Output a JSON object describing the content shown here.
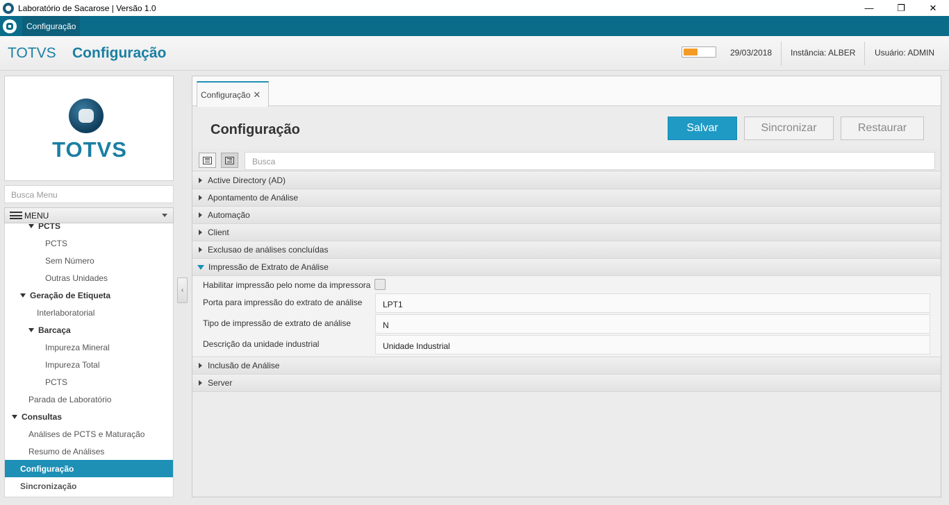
{
  "window": {
    "title": "Laboratório de Sacarose | Versão 1.0",
    "minimize": "—",
    "restore": "❐",
    "close": "✕"
  },
  "menubar": {
    "tab_label": "Configuração"
  },
  "header": {
    "brand": "TOTVS",
    "title": "Configuração",
    "progress_fraction": 0.45,
    "date": "29/03/2018",
    "instance": "Instância: ALBER",
    "user": "Usuário: ADMIN"
  },
  "sidebar": {
    "logo_text": "TOTVS",
    "search_placeholder": "Busca Menu",
    "menu_label": "MENU",
    "items": [
      {
        "label": "PCTS",
        "level": 2,
        "group": true
      },
      {
        "label": "PCTS",
        "level": 3
      },
      {
        "label": "Sem Número",
        "level": 3
      },
      {
        "label": "Outras Unidades",
        "level": 3
      },
      {
        "label": "Geração de Etiqueta",
        "level": 1,
        "group": true
      },
      {
        "label": "Interlaboratorial",
        "level": 2
      },
      {
        "label": "Barcaça",
        "level": 2,
        "group": true
      },
      {
        "label": "Impureza Mineral",
        "level": 3
      },
      {
        "label": "Impureza Total",
        "level": 3
      },
      {
        "label": "PCTS",
        "level": 3
      },
      {
        "label": "Parada de Laboratório",
        "level": 1
      },
      {
        "label": "Consultas",
        "level": 0,
        "group": true
      },
      {
        "label": "Análises de PCTS e Maturação",
        "level": 1
      },
      {
        "label": "Resumo de Análises",
        "level": 1
      },
      {
        "label": "Configuração",
        "level": 0,
        "selected": true
      },
      {
        "label": "Sincronização",
        "level": 0,
        "bold": true
      }
    ]
  },
  "main": {
    "tab_label": "Configuração",
    "tab_close": "✕",
    "title": "Configuração",
    "buttons": {
      "save": "Salvar",
      "sync": "Sincronizar",
      "restore": "Restaurar"
    },
    "search_placeholder": "Busca",
    "collapse_handle": "‹",
    "sections": [
      {
        "label": "Active Directory (AD)",
        "open": false
      },
      {
        "label": "Apontamento de Análise",
        "open": false
      },
      {
        "label": "Automação",
        "open": false
      },
      {
        "label": "Client",
        "open": false
      },
      {
        "label": "Exclusao de análises concluídas",
        "open": false
      },
      {
        "label": "Impressão de Extrato de Análise",
        "open": true
      },
      {
        "label": "Inclusão de Análise",
        "open": false
      },
      {
        "label": "Server",
        "open": false
      }
    ],
    "fields": {
      "print_by_name_label": "Habilitar impressão pelo nome da impressora",
      "print_by_name_checked": false,
      "port_label": "Porta para impressão do extrato de análise",
      "port_value": "LPT1",
      "type_label": "Tipo de impressão de extrato de análise",
      "type_value": "N",
      "unit_label": "Descrição da unidade industrial",
      "unit_value": "Unidade Industrial"
    }
  }
}
